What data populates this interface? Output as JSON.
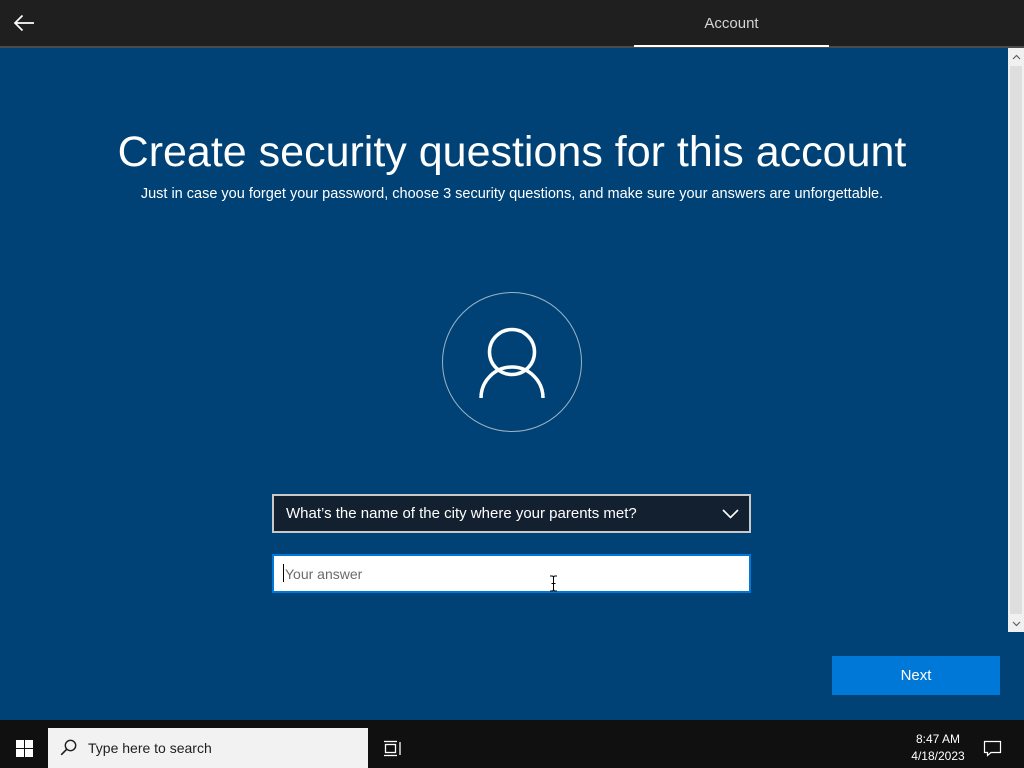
{
  "header": {
    "tab_label": "Account"
  },
  "main": {
    "title": "Create security questions for this account",
    "subtitle": "Just in case you forget your password, choose 3 security questions, and make sure your answers are unforgettable."
  },
  "security": {
    "selected_question": "What’s the name of the city where your parents met?",
    "answer_placeholder": "Your answer"
  },
  "actions": {
    "next_label": "Next"
  },
  "taskbar": {
    "search_placeholder": "Type here to search",
    "time": "8:47 AM",
    "date": "4/18/2023"
  },
  "icons": {
    "back": "back-arrow-icon",
    "avatar": "person-icon",
    "dropdown": "chevron-down-icon",
    "scroll_up": "scroll-up-arrow-icon",
    "scroll_down": "scroll-down-arrow-icon",
    "pointer": "text-ibeam-cursor-icon",
    "start": "windows-start-icon",
    "search": "search-icon",
    "task_view": "task-view-icon",
    "notifications": "notification-icon"
  },
  "colors": {
    "oobe_blue": "#004275",
    "accent": "#0078d7",
    "topbar": "#1f1f1f",
    "taskbar": "#101010",
    "dropdown_bg": "#13202f"
  }
}
